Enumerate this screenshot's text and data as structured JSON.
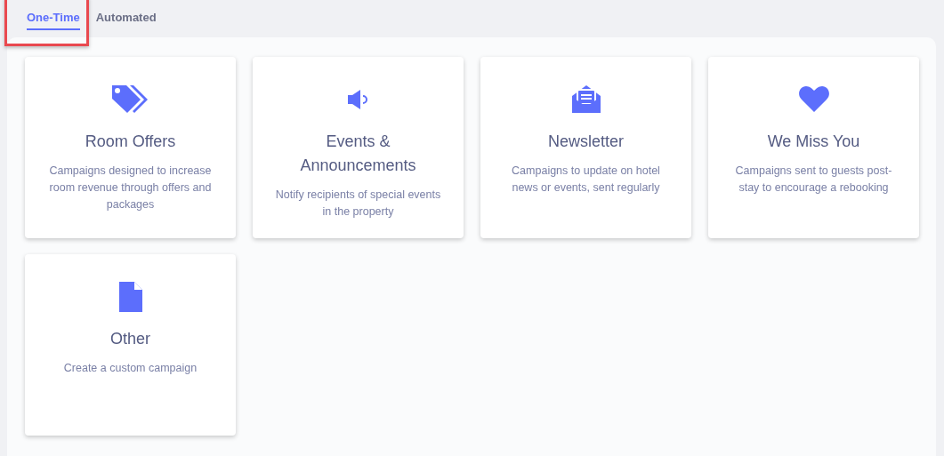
{
  "tabs": [
    {
      "label": "One-Time",
      "selected": true,
      "highlighted": true
    },
    {
      "label": "Automated",
      "selected": false,
      "highlighted": false
    }
  ],
  "cards": [
    {
      "kind": "tags",
      "title": "Room Offers",
      "description": "Campaigns designed to increase room revenue through offers and packages"
    },
    {
      "kind": "megaphone",
      "title": "Events & Announcements",
      "description": "Notify recipients of special events in the property"
    },
    {
      "kind": "envelope",
      "title": "Newsletter",
      "description": "Campaigns to update on hotel news or events, sent regularly"
    },
    {
      "kind": "heart",
      "title": "We Miss You",
      "description": "Campaigns sent to guests post-stay to encourage a rebooking"
    },
    {
      "kind": "file",
      "title": "Other",
      "description": "Create a custom campaign"
    }
  ]
}
